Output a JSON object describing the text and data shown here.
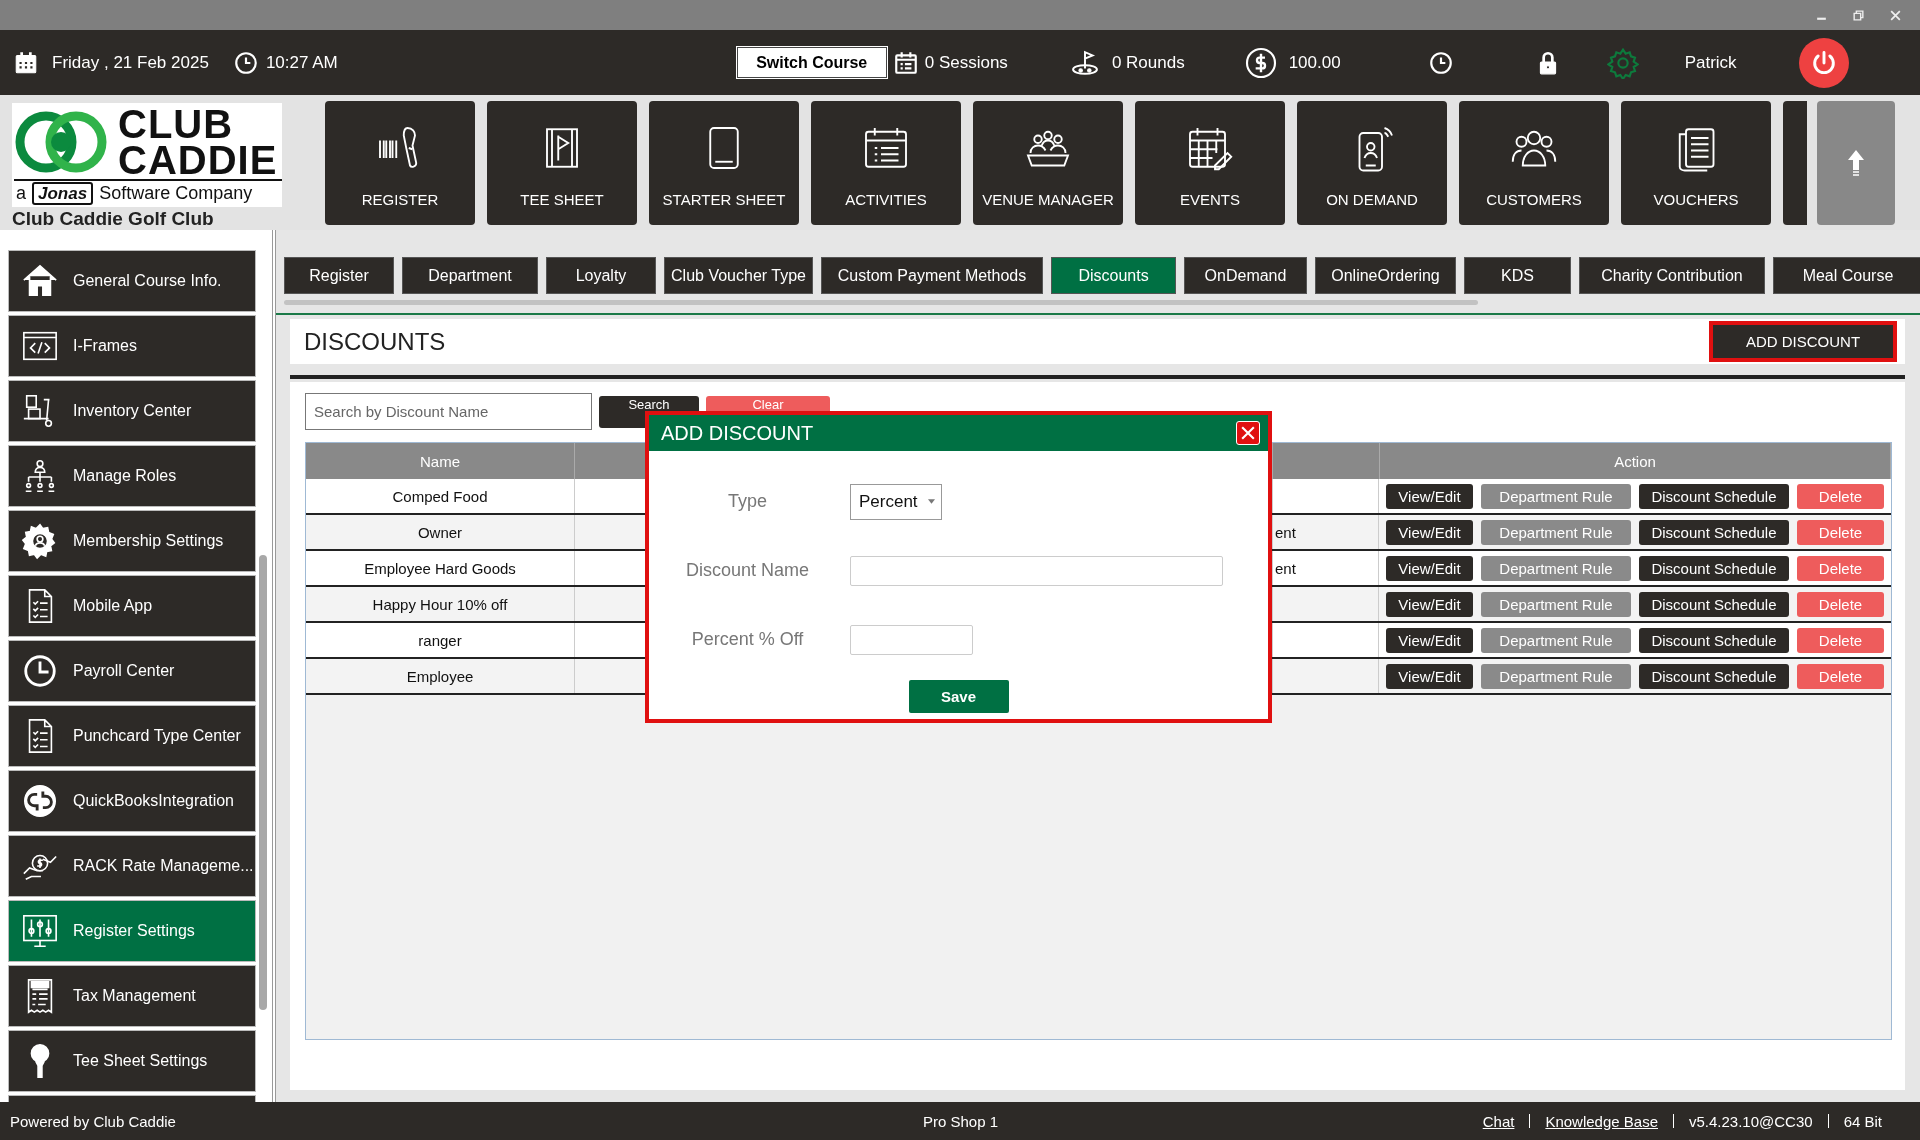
{
  "top_bar": {
    "date": "Friday , 21 Feb 2025",
    "time": "10:27 AM",
    "switch_course": "Switch Course",
    "sessions": "0 Sessions",
    "rounds": "0 Rounds",
    "balance": "100.00",
    "user": "Patrick"
  },
  "logo": {
    "line_1": "CLUB",
    "line_2": "CADDIE",
    "prefix": "a",
    "brand": "Jonas",
    "tagline": "Software Company"
  },
  "club_name": "Club Caddie Golf Club",
  "nav": [
    {
      "label": "REGISTER"
    },
    {
      "label": "TEE SHEET"
    },
    {
      "label": "STARTER SHEET"
    },
    {
      "label": "ACTIVITIES"
    },
    {
      "label": "VENUE MANAGER"
    },
    {
      "label": "EVENTS"
    },
    {
      "label": "ON DEMAND"
    },
    {
      "label": "CUSTOMERS"
    },
    {
      "label": "VOUCHERS"
    }
  ],
  "sidebar": {
    "items": [
      {
        "label": "General Course Info.",
        "selected": false
      },
      {
        "label": "I-Frames",
        "selected": false
      },
      {
        "label": "Inventory Center",
        "selected": false
      },
      {
        "label": "Manage Roles",
        "selected": false
      },
      {
        "label": "Membership Settings",
        "selected": false
      },
      {
        "label": "Mobile App",
        "selected": false
      },
      {
        "label": "Payroll Center",
        "selected": false
      },
      {
        "label": "Punchcard Type Center",
        "selected": false
      },
      {
        "label": "QuickBooksIntegration",
        "selected": false
      },
      {
        "label": "RACK Rate Manageme...",
        "selected": false
      },
      {
        "label": "Register Settings",
        "selected": true
      },
      {
        "label": "Tax Management",
        "selected": false
      },
      {
        "label": "Tee Sheet Settings",
        "selected": false
      }
    ]
  },
  "tabs": [
    {
      "label": "Register",
      "selected": false
    },
    {
      "label": "Department",
      "selected": false
    },
    {
      "label": "Loyalty",
      "selected": false
    },
    {
      "label": "Club Voucher Type",
      "selected": false
    },
    {
      "label": "Custom Payment Methods",
      "selected": false
    },
    {
      "label": "Discounts",
      "selected": true
    },
    {
      "label": "OnDemand",
      "selected": false
    },
    {
      "label": "OnlineOrdering",
      "selected": false
    },
    {
      "label": "KDS",
      "selected": false
    },
    {
      "label": "Charity Contribution",
      "selected": false
    },
    {
      "label": "Meal Course",
      "selected": false
    }
  ],
  "page": {
    "title": "DISCOUNTS",
    "add_button": "ADD DISCOUNT"
  },
  "search": {
    "placeholder": "Search by Discount Name",
    "search_button": "Search",
    "clear_button": "Clear"
  },
  "table": {
    "columns": [
      {
        "label": "Name"
      },
      {
        "label": "Action"
      }
    ],
    "rows": [
      {
        "name": "Comped Food",
        "actions": [
          {
            "label": "View/Edit",
            "kind": "primary"
          },
          {
            "label": "Department Rule",
            "kind": "secondary"
          },
          {
            "label": "Discount Schedule",
            "kind": "primary"
          },
          {
            "label": "Delete",
            "kind": "danger"
          }
        ]
      },
      {
        "name": "Owner",
        "column_3": "ent",
        "actions": [
          {
            "label": "View/Edit",
            "kind": "primary"
          },
          {
            "label": "Department Rule",
            "kind": "secondary"
          },
          {
            "label": "Discount Schedule",
            "kind": "primary"
          },
          {
            "label": "Delete",
            "kind": "danger"
          }
        ]
      },
      {
        "name": "Employee Hard Goods",
        "column_3": "ent",
        "actions": [
          {
            "label": "View/Edit",
            "kind": "primary"
          },
          {
            "label": "Department Rule",
            "kind": "secondary"
          },
          {
            "label": "Discount Schedule",
            "kind": "primary"
          },
          {
            "label": "Delete",
            "kind": "danger"
          }
        ]
      },
      {
        "name": "Happy Hour 10% off",
        "actions": [
          {
            "label": "View/Edit",
            "kind": "primary"
          },
          {
            "label": "Department Rule",
            "kind": "secondary"
          },
          {
            "label": "Discount Schedule",
            "kind": "primary"
          },
          {
            "label": "Delete",
            "kind": "danger"
          }
        ]
      },
      {
        "name": "ranger",
        "actions": [
          {
            "label": "View/Edit",
            "kind": "primary"
          },
          {
            "label": "Department Rule",
            "kind": "secondary"
          },
          {
            "label": "Discount Schedule",
            "kind": "primary"
          },
          {
            "label": "Delete",
            "kind": "danger"
          }
        ]
      },
      {
        "name": "Employee",
        "actions": [
          {
            "label": "View/Edit",
            "kind": "primary"
          },
          {
            "label": "Department Rule",
            "kind": "secondary"
          },
          {
            "label": "Discount Schedule",
            "kind": "primary"
          },
          {
            "label": "Delete",
            "kind": "danger"
          }
        ]
      }
    ]
  },
  "modal": {
    "title": "ADD DISCOUNT",
    "fields": [
      {
        "label": "Type",
        "kind": "select",
        "value": "Percent"
      },
      {
        "label": "Discount Name",
        "kind": "text"
      },
      {
        "label": "Percent % Off",
        "kind": "number"
      }
    ],
    "save_button": "Save"
  },
  "footer": {
    "powered_by": "Powered by Club Caddie",
    "location": "Pro Shop 1",
    "links": [
      "Chat",
      "Knowledge Base"
    ],
    "version": "v5.4.23.10@CC30",
    "bits": "64 Bit"
  }
}
